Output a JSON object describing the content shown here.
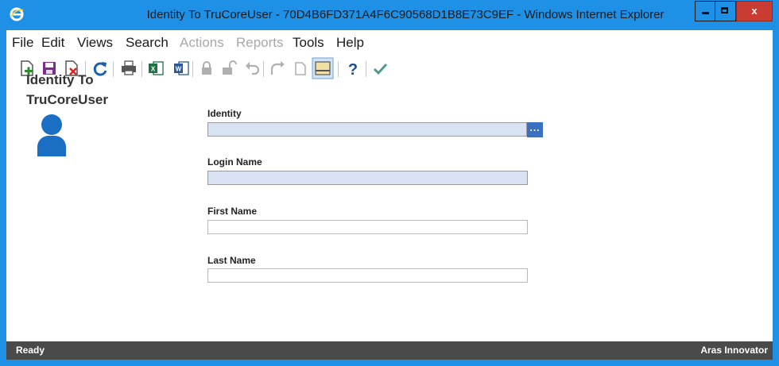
{
  "window": {
    "title": "Identity To TruCoreUser - 70D4B6FD371A4F6C90568D1B8E73C9EF - Windows Internet Explorer",
    "close_label": "x",
    "frame_color": "#1e90e6"
  },
  "menu": [
    {
      "label": "File",
      "enabled": true
    },
    {
      "label": "Edit",
      "enabled": true
    },
    {
      "label": "Views",
      "enabled": true
    },
    {
      "label": "Search",
      "enabled": true
    },
    {
      "label": "Actions",
      "enabled": false
    },
    {
      "label": "Reports",
      "enabled": false
    },
    {
      "label": "Tools",
      "enabled": true
    },
    {
      "label": "Help",
      "enabled": true
    }
  ],
  "toolbar": [
    {
      "icon": "new-icon",
      "enabled": true
    },
    {
      "icon": "save-icon",
      "enabled": true
    },
    {
      "icon": "delete-icon",
      "enabled": true
    },
    {
      "icon": "refresh-icon",
      "enabled": true
    },
    {
      "icon": "print-icon",
      "enabled": true
    },
    {
      "icon": "excel-icon",
      "enabled": true
    },
    {
      "icon": "word-icon",
      "enabled": true
    },
    {
      "icon": "lock-icon",
      "enabled": false
    },
    {
      "icon": "unlock-icon",
      "enabled": false
    },
    {
      "icon": "undo-icon",
      "enabled": false
    },
    {
      "icon": "promote-icon",
      "enabled": false
    },
    {
      "icon": "version-icon",
      "enabled": false
    },
    {
      "icon": "toggle-panel-icon",
      "enabled": true
    },
    {
      "icon": "help-icon",
      "enabled": true
    },
    {
      "icon": "done-icon",
      "enabled": true
    }
  ],
  "item": {
    "title_line1": "Identity To",
    "title_line2": "TruCoreUser",
    "icon": "user-icon"
  },
  "form": {
    "identity_label": "Identity",
    "identity_value": "",
    "identity_picker": "...",
    "login_label": "Login Name",
    "login_value": "",
    "first_label": "First Name",
    "first_value": "",
    "last_label": "Last Name",
    "last_value": ""
  },
  "status": {
    "left": "Ready",
    "right": "Aras Innovator"
  },
  "colors": {
    "required_field": "#d9e2f3",
    "picker_button": "#3a6fc2",
    "status_bar": "#4a4a4a"
  }
}
